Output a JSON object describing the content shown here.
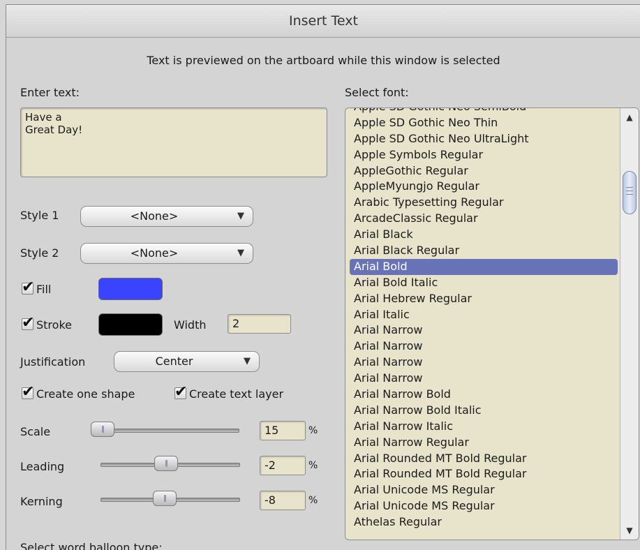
{
  "window": {
    "title": "Insert Text"
  },
  "info_text": "Text is previewed on the artboard while this window is selected",
  "enter_text": {
    "label": "Enter text:",
    "value": "Have a\nGreat Day!"
  },
  "style1": {
    "label": "Style 1",
    "value": "<None>"
  },
  "style2": {
    "label": "Style 2",
    "value": "<None>"
  },
  "fill": {
    "label": "Fill",
    "checked": true,
    "color": "#3a44ff"
  },
  "stroke": {
    "label": "Stroke",
    "checked": true,
    "color": "#000000",
    "width_label": "Width",
    "width_value": "2"
  },
  "justification": {
    "label": "Justification",
    "value": "Center"
  },
  "create_one_shape": {
    "label": "Create one shape",
    "checked": true
  },
  "create_text_layer": {
    "label": "Create text layer",
    "checked": true
  },
  "scale": {
    "label": "Scale",
    "value": "15",
    "unit": "%"
  },
  "leading": {
    "label": "Leading",
    "value": "-2",
    "unit": "%"
  },
  "kerning": {
    "label": "Kerning",
    "value": "-8",
    "unit": "%"
  },
  "balloon_label": "Select word balloon type:",
  "font_list": {
    "label": "Select font:",
    "selected": "Arial Bold",
    "items": [
      "Apple SD Gothic Neo SemiBold",
      "Apple SD Gothic Neo Thin",
      "Apple SD Gothic Neo UltraLight",
      "Apple Symbols Regular",
      "AppleGothic Regular",
      "AppleMyungjo Regular",
      "Arabic Typesetting Regular",
      "ArcadeClassic Regular",
      "Arial Black",
      "Arial Black Regular",
      "Arial Bold",
      "Arial Bold Italic",
      "Arial Hebrew Regular",
      "Arial Italic",
      "Arial Narrow",
      "Arial Narrow",
      "Arial Narrow",
      "Arial Narrow",
      "Arial Narrow Bold",
      "Arial Narrow Bold Italic",
      "Arial Narrow Italic",
      "Arial Narrow Regular",
      "Arial Rounded MT Bold Regular",
      "Arial Rounded MT Bold Regular",
      "Arial Unicode MS Regular",
      "Arial Unicode MS Regular",
      "Athelas Regular"
    ]
  },
  "scrollbar": {
    "up_icon": "▲",
    "down_icon": "▼"
  }
}
